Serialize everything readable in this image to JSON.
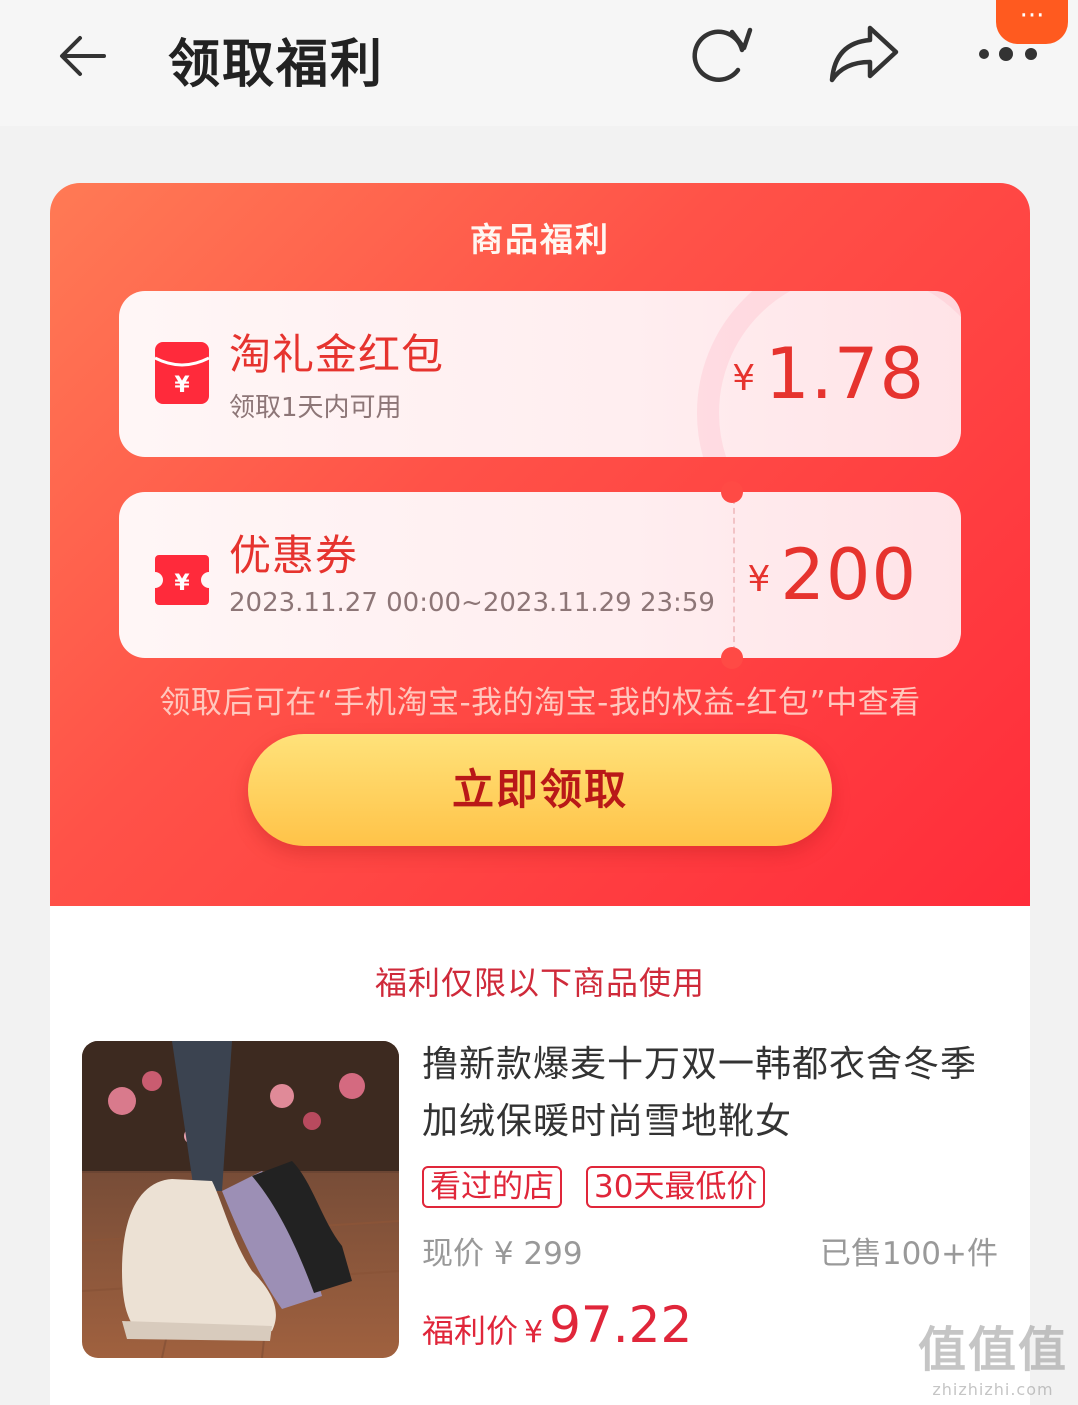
{
  "header": {
    "title": "领取福利",
    "back_icon": "arrow-left-icon",
    "refresh_icon": "refresh-icon",
    "share_icon": "share-icon",
    "more_icon": "more-dots-icon",
    "notification_badge": "···"
  },
  "benefits": {
    "title": "商品福利",
    "items": [
      {
        "name": "淘礼金红包",
        "subtitle": "领取1天内可用",
        "currency": "¥",
        "amount": "1.78",
        "icon": "red-envelope-icon"
      },
      {
        "name": "优惠券",
        "subtitle": "2023.11.27 00:00~2023.11.29 23:59",
        "currency": "¥",
        "amount": "200",
        "icon": "coupon-icon"
      }
    ],
    "hint": "领取后可在“手机淘宝-我的淘宝-我的权益-红包”中查看",
    "claim_label": "立即领取"
  },
  "product": {
    "limit_text": "福利仅限以下商品使用",
    "name": "撸新款爆麦十万双一韩都衣舍冬季加绒保暖时尚雪地靴女",
    "tags": [
      "看过的店",
      "30天最低价"
    ],
    "current_price": "现价 ¥ 299",
    "sold": "已售100+件",
    "deal_label": "福利价",
    "deal_currency": "¥",
    "deal_price": "97.22"
  },
  "watermark": {
    "text": "值值值",
    "domain": "zhizhizhi.com"
  },
  "colors": {
    "accent_red": "#e6332e",
    "card_gradient_start": "#ff7a55",
    "card_gradient_end": "#ff2c3a",
    "button_yellow": "#ffc348"
  }
}
